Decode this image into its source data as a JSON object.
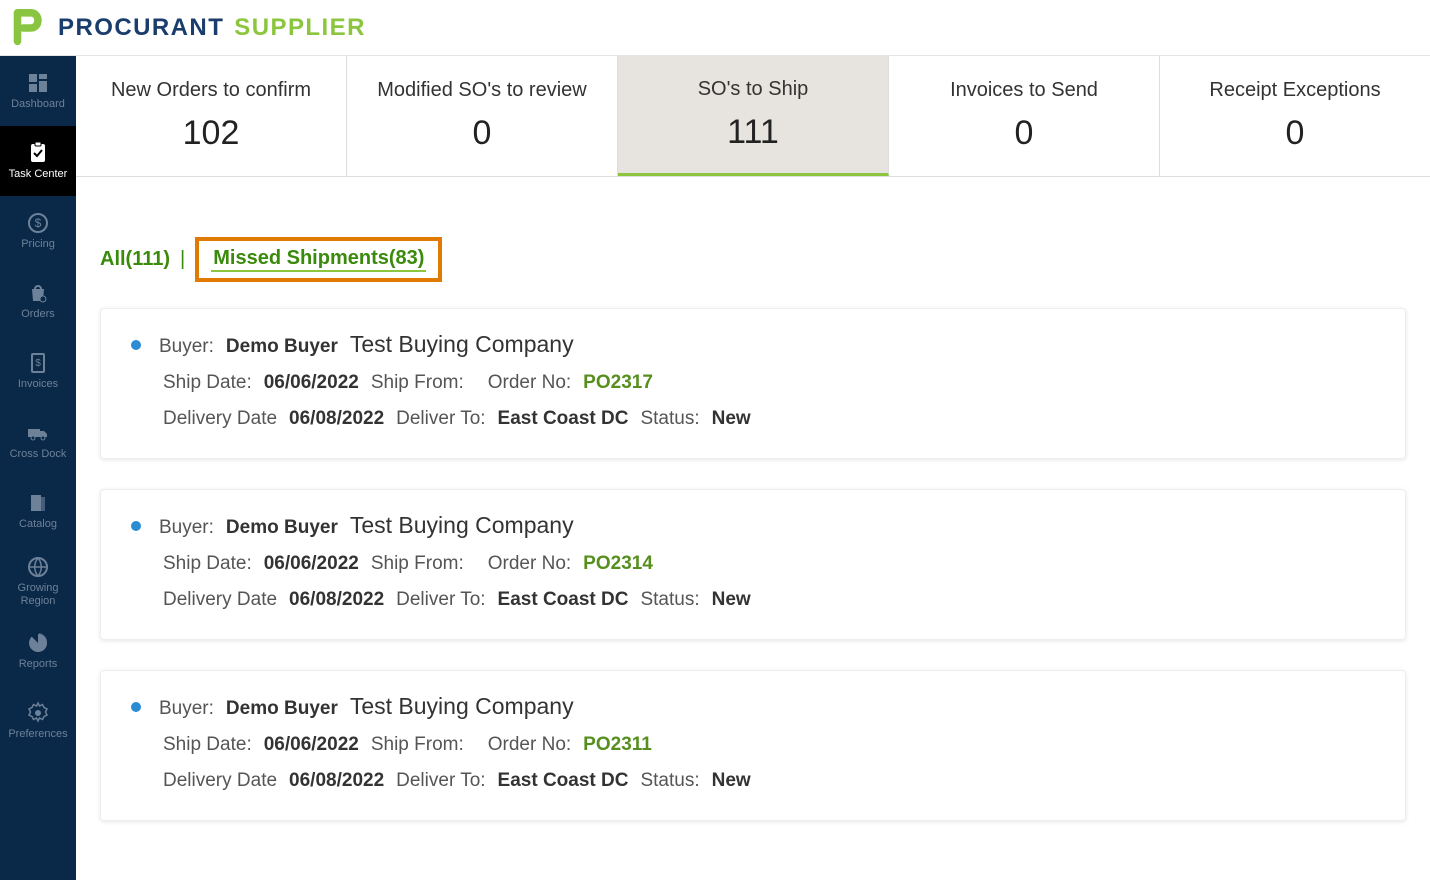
{
  "brand": {
    "primary": "PROCURANT",
    "secondary": "SUPPLIER"
  },
  "sidebar": {
    "items": [
      {
        "label": "Dashboard"
      },
      {
        "label": "Task Center"
      },
      {
        "label": "Pricing"
      },
      {
        "label": "Orders"
      },
      {
        "label": "Invoices"
      },
      {
        "label": "Cross Dock"
      },
      {
        "label": "Catalog"
      },
      {
        "label": "Growing Region"
      },
      {
        "label": "Reports"
      },
      {
        "label": "Preferences"
      }
    ]
  },
  "stats": [
    {
      "title": "New Orders to confirm",
      "value": "102"
    },
    {
      "title": "Modified SO's to review",
      "value": "0"
    },
    {
      "title": "SO's to Ship",
      "value": "111"
    },
    {
      "title": "Invoices to Send",
      "value": "0"
    },
    {
      "title": "Receipt Exceptions",
      "value": "0"
    }
  ],
  "filters": {
    "all": "All(111)",
    "missed": "Missed Shipments(83)"
  },
  "labels": {
    "buyer": "Buyer:",
    "shipDate": "Ship Date:",
    "shipFrom": "Ship From:",
    "orderNo": "Order No:",
    "deliveryDate": "Delivery Date",
    "deliverTo": "Deliver To:",
    "status": "Status:"
  },
  "orders": [
    {
      "buyerTag": "Demo Buyer",
      "company": "Test Buying Company",
      "shipDate": "06/06/2022",
      "shipFrom": "",
      "orderNo": "PO2317",
      "deliveryDate": "06/08/2022",
      "deliverTo": "East Coast DC",
      "status": "New"
    },
    {
      "buyerTag": "Demo Buyer",
      "company": "Test Buying Company",
      "shipDate": "06/06/2022",
      "shipFrom": "",
      "orderNo": "PO2314",
      "deliveryDate": "06/08/2022",
      "deliverTo": "East Coast DC",
      "status": "New"
    },
    {
      "buyerTag": "Demo Buyer",
      "company": "Test Buying Company",
      "shipDate": "06/06/2022",
      "shipFrom": "",
      "orderNo": "PO2311",
      "deliveryDate": "06/08/2022",
      "deliverTo": "East Coast DC",
      "status": "New"
    }
  ]
}
